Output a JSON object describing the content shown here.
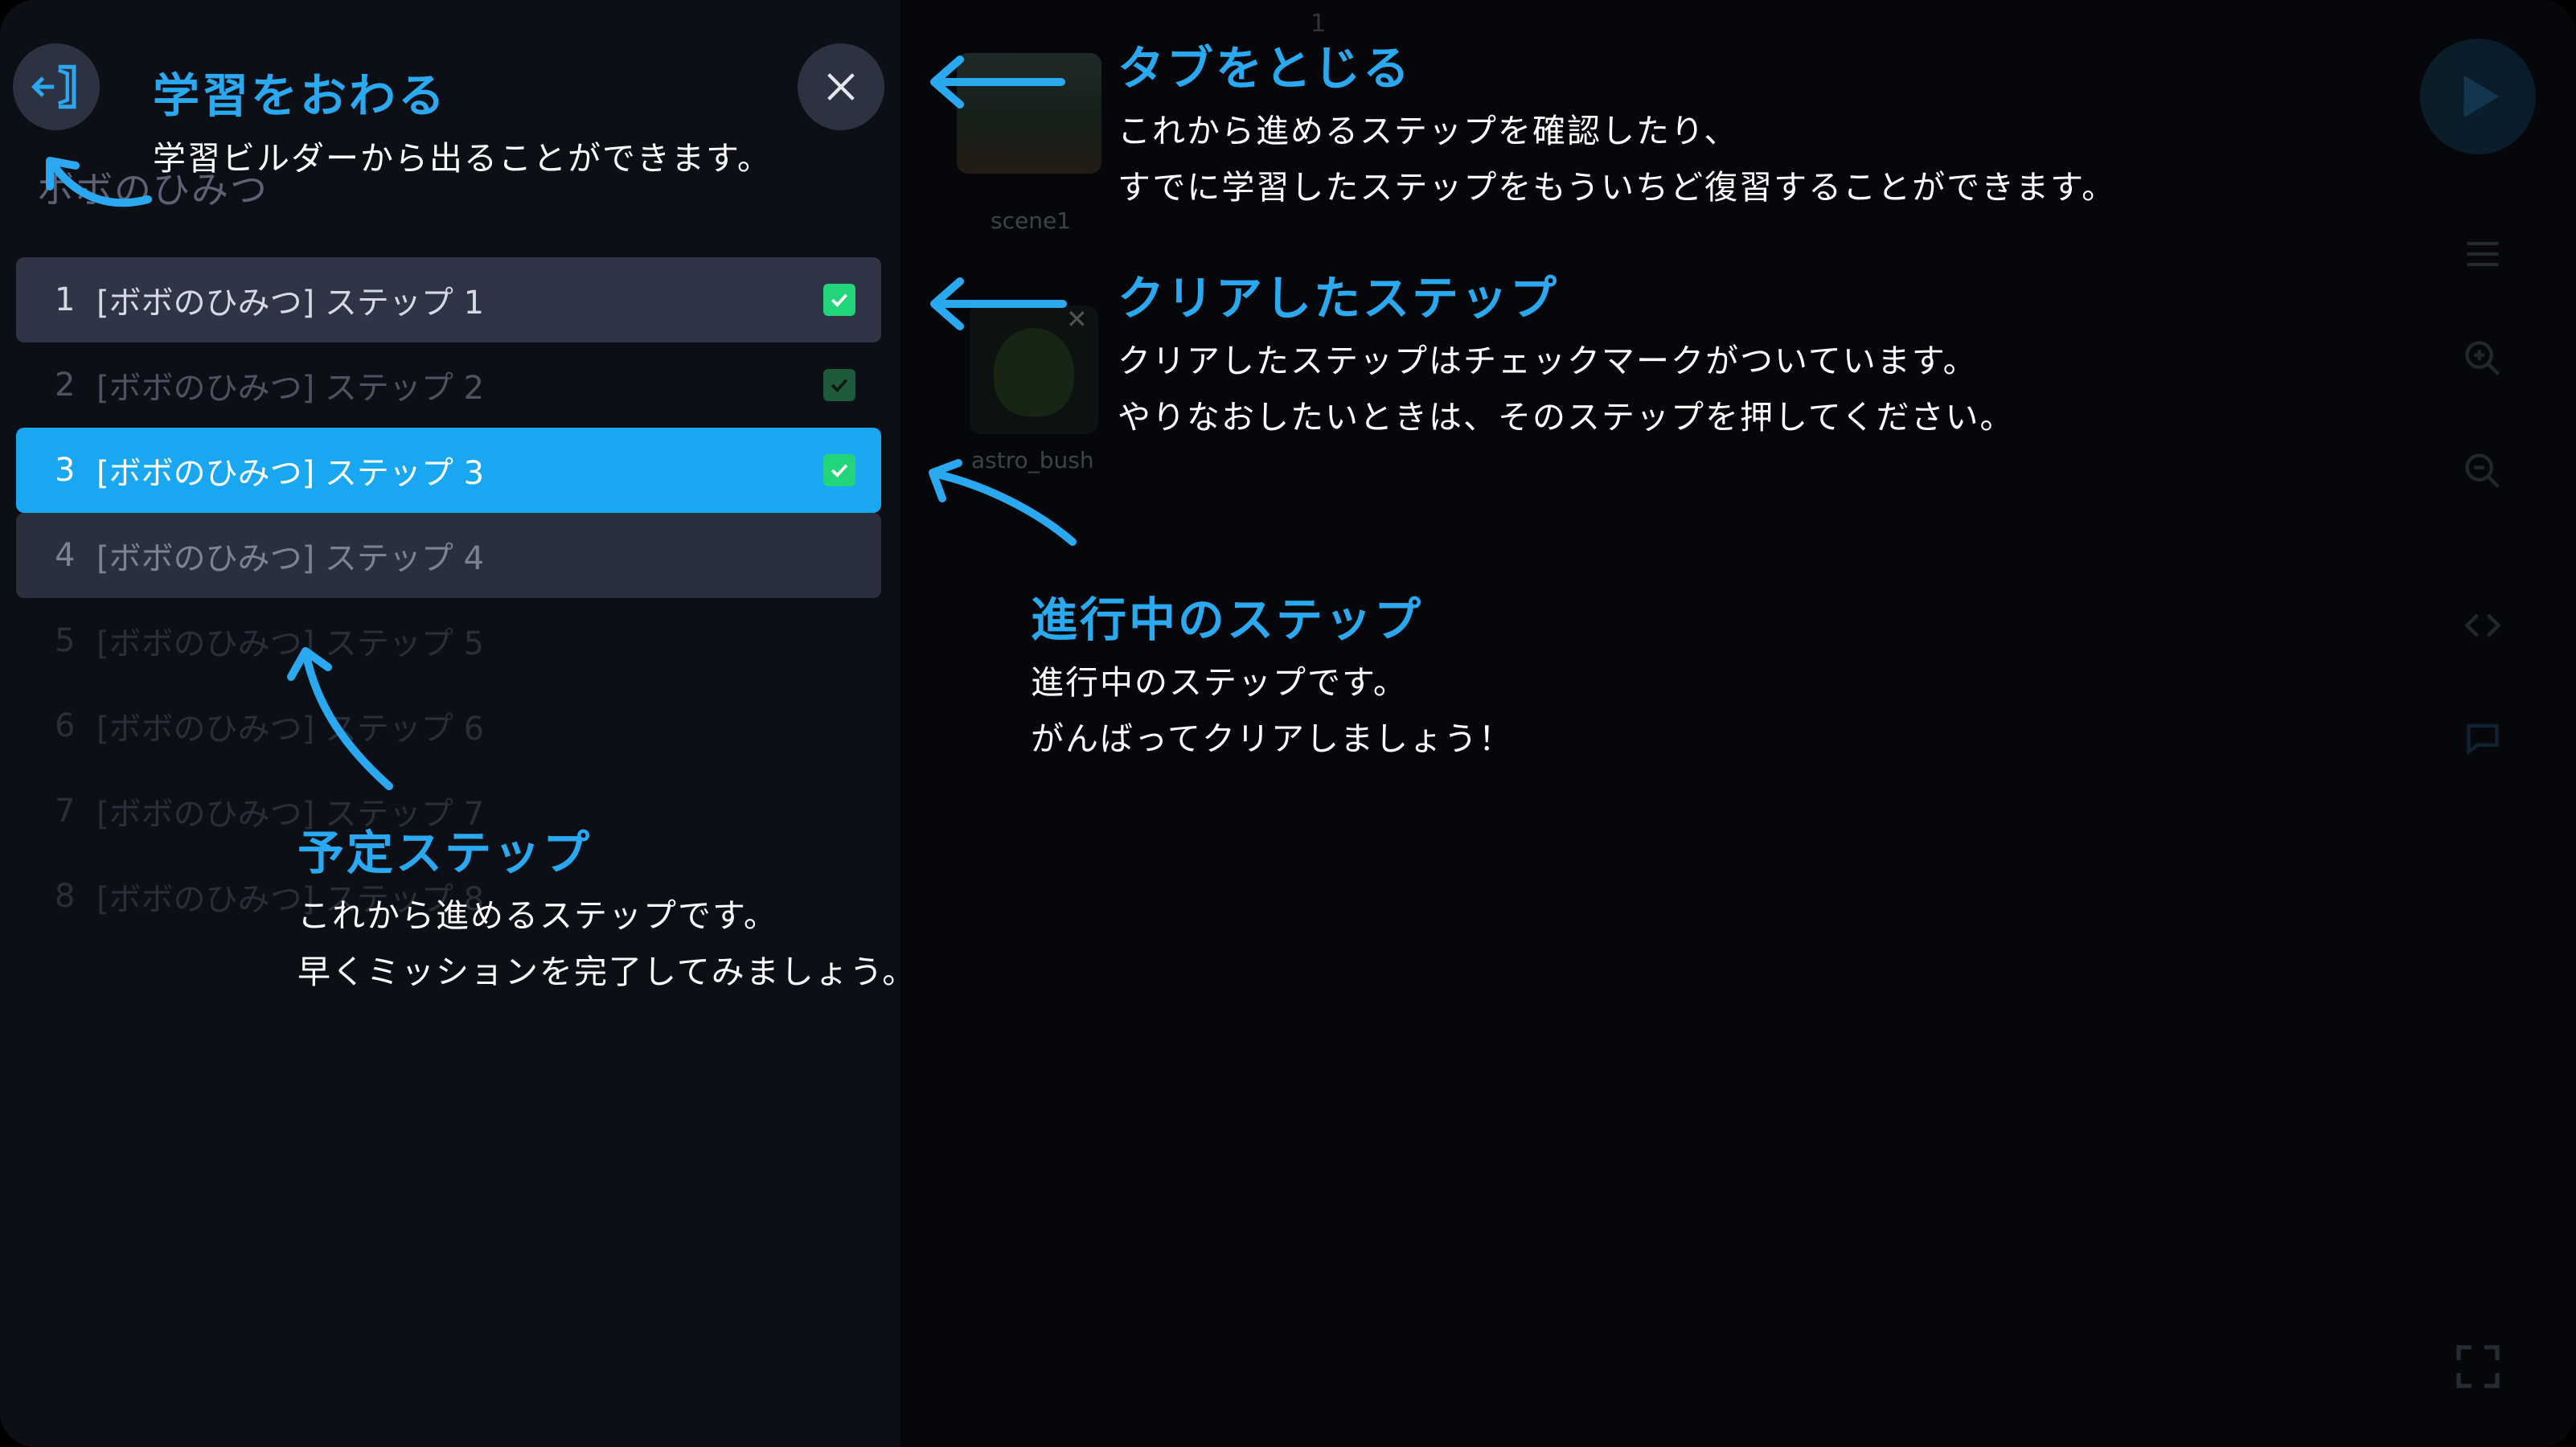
{
  "workspace": {
    "tab_number": "1",
    "scene_label": "scene1",
    "sprite_label": "astro_bush"
  },
  "panel": {
    "course_title": "ボボのひみつ",
    "steps": [
      {
        "num": "1",
        "label": "[ボボのひみつ] ステップ 1",
        "state": "cleared"
      },
      {
        "num": "2",
        "label": "[ボボのひみつ] ステップ 2",
        "state": "cleared"
      },
      {
        "num": "3",
        "label": "[ボボのひみつ] ステップ 3",
        "state": "current"
      },
      {
        "num": "4",
        "label": "[ボボのひみつ] ステップ 4",
        "state": "next"
      },
      {
        "num": "5",
        "label": "[ボボのひみつ] ステップ 5",
        "state": "upcoming"
      },
      {
        "num": "6",
        "label": "[ボボのひみつ] ステップ 6",
        "state": "upcoming"
      },
      {
        "num": "7",
        "label": "[ボボのひみつ] ステップ 7",
        "state": "upcoming"
      },
      {
        "num": "8",
        "label": "[ボボのひみつ] ステップ 8",
        "state": "upcoming"
      }
    ]
  },
  "annotations": {
    "exit": {
      "title": "学習をおわる",
      "lines": [
        "学習ビルダーから出ることができます。"
      ]
    },
    "close_tab": {
      "title": "タブをとじる",
      "lines": [
        "これから進めるステップを確認したり、",
        "すでに学習したステップをもういちど復習することができます。"
      ]
    },
    "cleared": {
      "title": "クリアしたステップ",
      "lines": [
        "クリアしたステップはチェックマークがついています。",
        "やりなおしたいときは、そのステップを押してください。"
      ]
    },
    "current": {
      "title": "進行中のステップ",
      "lines": [
        "進行中のステップです。",
        "がんばってクリアしましょう！"
      ]
    },
    "upcoming": {
      "title": "予定ステップ",
      "lines": [
        "これから進めるステップです。",
        "早くミッションを完了してみましょう。"
      ]
    }
  },
  "colors": {
    "accent": "#2aa9f0",
    "current_step": "#1aa7f2",
    "check": "#22d47a",
    "panel_bg": "#0d0f16"
  },
  "icons": [
    "exit-door-icon",
    "close-icon",
    "checkmark-icon",
    "play-icon",
    "fullscreen-icon"
  ]
}
